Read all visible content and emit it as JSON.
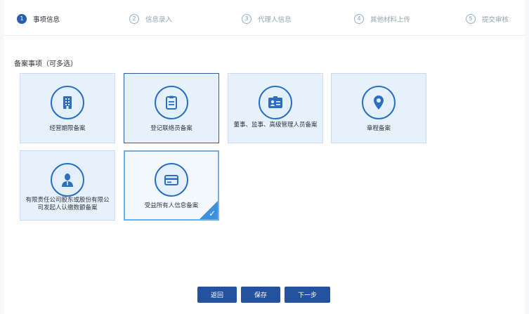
{
  "steps": [
    {
      "num": "1",
      "label": "事项信息",
      "active": true
    },
    {
      "num": "2",
      "label": "信息录入",
      "active": false
    },
    {
      "num": "3",
      "label": "代理人信息",
      "active": false
    },
    {
      "num": "4",
      "label": "其他材料上传",
      "active": false
    },
    {
      "num": "5",
      "label": "提交审核",
      "active": false
    }
  ],
  "section_title": "备案事项（可多选）",
  "cards": [
    {
      "label": "经营期限备案",
      "icon": "building-icon"
    },
    {
      "label": "登记联络员备案",
      "icon": "clipboard-icon"
    },
    {
      "label": "董事、监事、高级管理人员备案",
      "icon": "id-card-icon"
    },
    {
      "label": "章程备案",
      "icon": "location-pin-icon"
    },
    {
      "label": "有限责任公司股东或股份有限公司发起人认缴数额备案",
      "icon": "person-icon"
    },
    {
      "label": "受益所有人信息备案",
      "icon": "card-icon",
      "checked": true
    }
  ],
  "buttons": {
    "back": "返回",
    "save": "保存",
    "next": "下一步"
  },
  "colors": {
    "primary": "#24529f",
    "card_bg": "#e7f1fc",
    "icon_stroke": "#2a6fc4",
    "check_bg": "#3d8fe0"
  }
}
